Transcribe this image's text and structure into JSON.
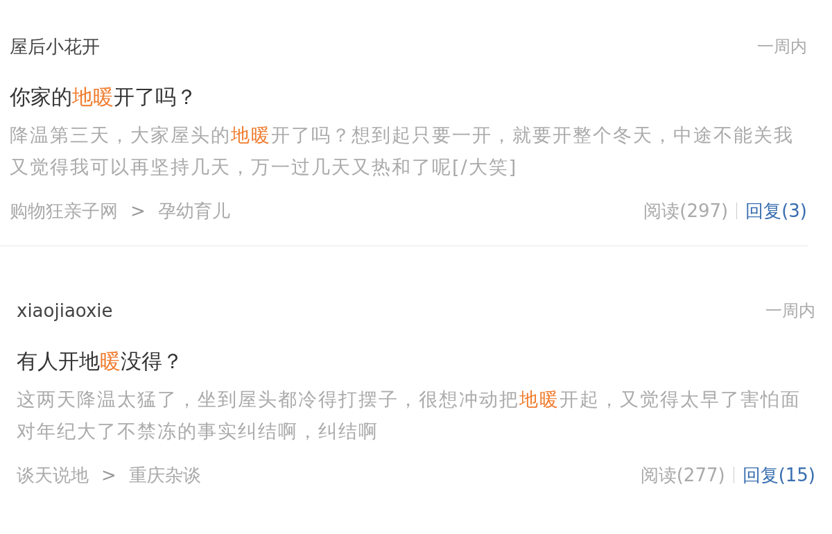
{
  "posts": [
    {
      "author": "屋后小花开",
      "time": "一周内",
      "title": [
        {
          "text": "你家的",
          "highlight": false
        },
        {
          "text": "地暖",
          "highlight": true
        },
        {
          "text": "开了吗？",
          "highlight": false
        }
      ],
      "body_lines": [
        [
          {
            "text": "降温第三天，大家屋头的",
            "highlight": false
          },
          {
            "text": "地暖",
            "highlight": true
          },
          {
            "text": "开了吗？想到起只要一开，就要开整个冬天，中途不能关我",
            "highlight": false
          }
        ],
        [
          {
            "text": "又觉得我可以再坚持几天，万一过几天又热和了呢[/大笑]",
            "highlight": false
          }
        ]
      ],
      "forum": "购物狂亲子网",
      "sep": ">",
      "board": "孕幼育儿",
      "reads": "阅读(297)",
      "replies": "回复(3)"
    },
    {
      "author": "xiaojiaoxie",
      "time": "一周内",
      "title": [
        {
          "text": "有人开地",
          "highlight": false
        },
        {
          "text": "暖",
          "highlight": true
        },
        {
          "text": "没得？",
          "highlight": false
        }
      ],
      "body_lines": [
        [
          {
            "text": "这两天降温太猛了，坐到屋头都冷得打摆子，很想冲动把",
            "highlight": false
          },
          {
            "text": "地暖",
            "highlight": true
          },
          {
            "text": "开起，又觉得太早了害怕面",
            "highlight": false
          }
        ],
        [
          {
            "text": "对年纪大了不禁冻的事实纠结啊，纠结啊",
            "highlight": false
          }
        ]
      ],
      "forum": "谈天说地",
      "sep": ">",
      "board": "重庆杂谈",
      "reads": "阅读(277)",
      "replies": "回复(15)"
    }
  ]
}
